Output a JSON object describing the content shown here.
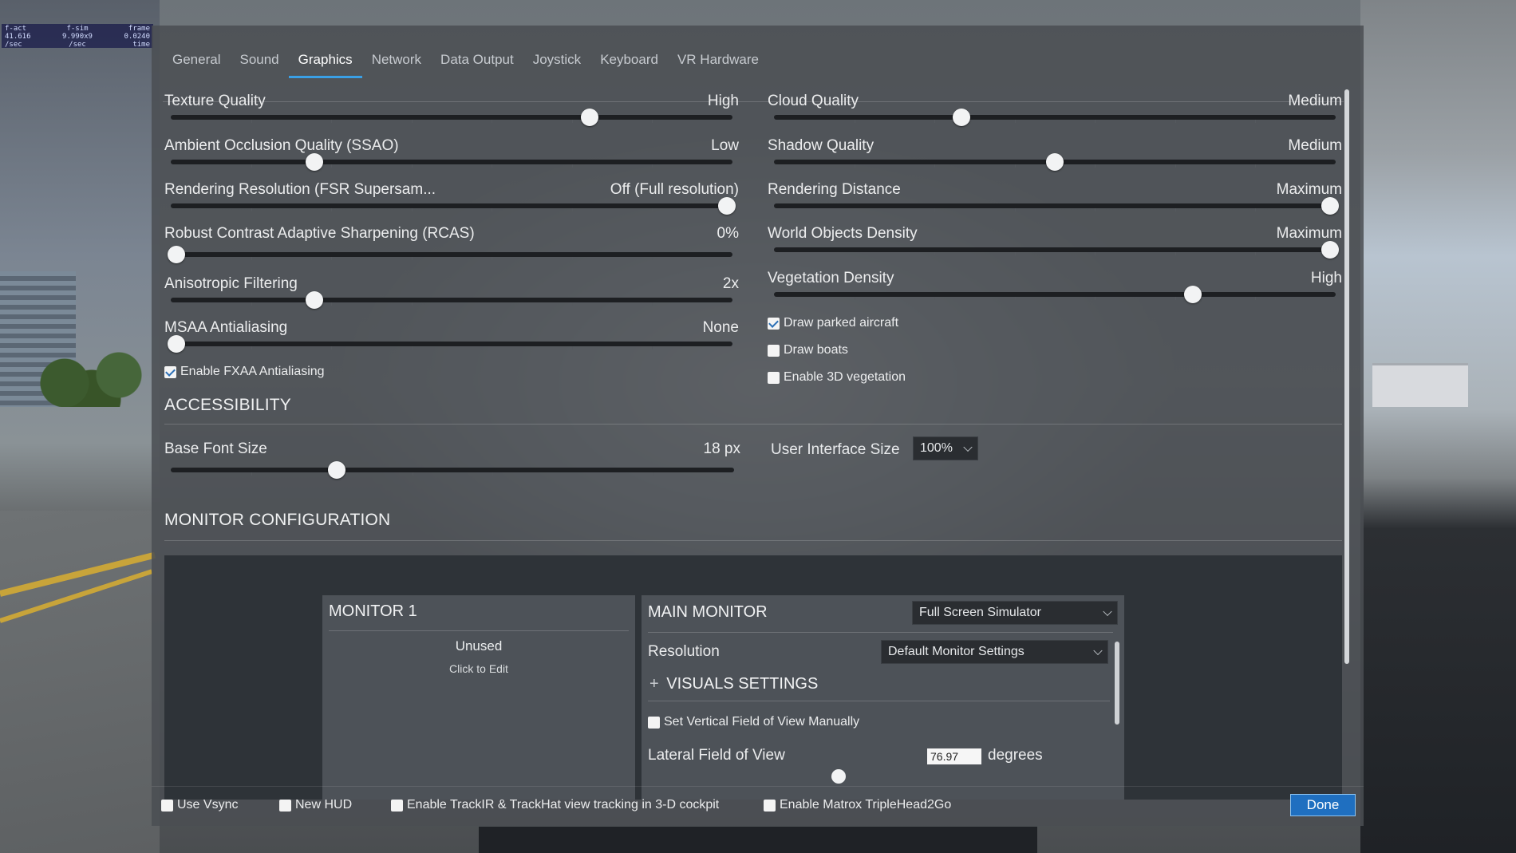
{
  "debug_overlay": {
    "row1": [
      "f-act",
      "f-sim",
      "frame"
    ],
    "row2": [
      "41.616",
      "9.990x9",
      "0.0240"
    ],
    "row3": [
      "/sec",
      "/sec",
      "time"
    ]
  },
  "tabs": [
    {
      "label": "General",
      "active": false
    },
    {
      "label": "Sound",
      "active": false
    },
    {
      "label": "Graphics",
      "active": true
    },
    {
      "label": "Network",
      "active": false
    },
    {
      "label": "Data Output",
      "active": false
    },
    {
      "label": "Joystick",
      "active": false
    },
    {
      "label": "Keyboard",
      "active": false
    },
    {
      "label": "VR Hardware",
      "active": false
    }
  ],
  "graphics": {
    "left": {
      "texture_quality": {
        "label": "Texture Quality",
        "value": "High",
        "level": 0.75
      },
      "ssao": {
        "label": "Ambient Occlusion Quality (SSAO)",
        "value": "Low",
        "level": 0.25
      },
      "fsr": {
        "label": "Rendering Resolution (FSR Supersam...",
        "value": "Off (Full resolution)",
        "level": 1.0
      },
      "rcas": {
        "label": "Robust Contrast Adaptive Sharpening (RCAS)",
        "value": "0%",
        "level": 0.0
      },
      "anisotropic": {
        "label": "Anisotropic Filtering",
        "value": "2x",
        "level": 0.25
      },
      "msaa": {
        "label": "MSAA Antialiasing",
        "value": "None",
        "level": 0.0
      },
      "fxaa_label": "Enable FXAA Antialiasing"
    },
    "right": {
      "cloud_quality": {
        "label": "Cloud Quality",
        "value": "Medium",
        "level": 0.33
      },
      "shadow_quality": {
        "label": "Shadow Quality",
        "value": "Medium",
        "level": 0.5
      },
      "render_distance": {
        "label": "Rendering Distance",
        "value": "Maximum",
        "level": 1.0
      },
      "world_objects": {
        "label": "World Objects Density",
        "value": "Maximum",
        "level": 1.0
      },
      "vegetation": {
        "label": "Vegetation Density",
        "value": "High",
        "level": 0.75
      },
      "parked_label": "Draw parked aircraft",
      "boats_label": "Draw boats",
      "veg3d_label": "Enable 3D vegetation"
    }
  },
  "accessibility": {
    "title": "ACCESSIBILITY",
    "font_size_label": "Base Font Size",
    "font_size_value": "18 px",
    "font_size_level": 0.29,
    "ui_size_label": "User Interface Size",
    "ui_size_value": "100%"
  },
  "monitor_config": {
    "title": "MONITOR CONFIGURATION",
    "monitor1_title": "MONITOR 1",
    "monitor1_status": "Unused",
    "monitor1_action": "Click to Edit",
    "main_title": "MAIN MONITOR",
    "main_mode": "Full Screen Simulator",
    "resolution_label": "Resolution",
    "resolution_value": "Default Monitor Settings",
    "visuals_title": "VISUALS SETTINGS",
    "visuals_expand": "+",
    "vfov_label": "Set Vertical Field of View Manually",
    "lateral_fov_label": "Lateral Field of View",
    "lateral_fov_value": "76.97",
    "lateral_fov_unit": "degrees"
  },
  "footer": {
    "vsync_label": "Use Vsync",
    "newhud_label": "New HUD",
    "trackir_label": "Enable TrackIR & TrackHat view tracking in 3-D cockpit",
    "matrox_label": "Enable Matrox TripleHead2Go",
    "done_label": "Done"
  },
  "checkboxes": {
    "fxaa": true,
    "parked": true,
    "boats": false,
    "veg3d": false,
    "vfov": false,
    "vsync": false,
    "newhud": false,
    "trackir": false,
    "matrox": false
  },
  "colors": {
    "accent": "#3aa0e6",
    "done_button": "#1f6fc0"
  }
}
